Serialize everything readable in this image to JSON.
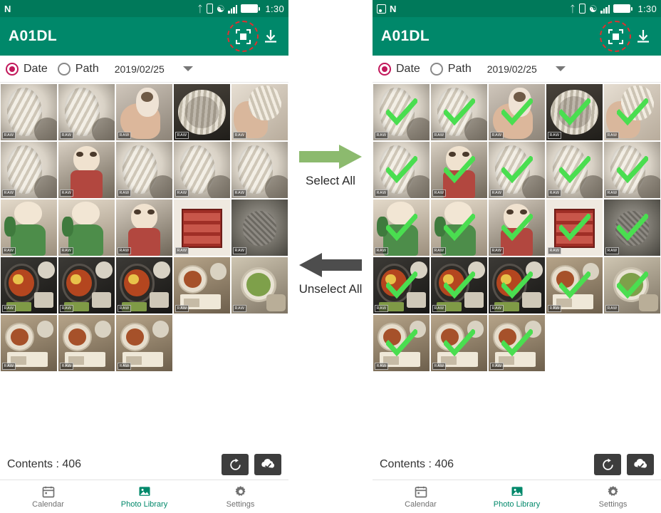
{
  "app": {
    "title": "A01DL",
    "brand_color": "#00886a",
    "status_bar_color": "#00795a",
    "accent_radio_color": "#c2185b",
    "check_color": "#4ade50"
  },
  "status_bar": {
    "clock": "1:30",
    "left_icons_left_phone": [
      "n-icon"
    ],
    "left_icons_right_phone": [
      "image-icon",
      "n-icon"
    ],
    "right_icons": [
      "bluetooth-icon",
      "vibrate-icon",
      "wifi-icon",
      "signal-bars-icon",
      "battery-icon"
    ]
  },
  "appbar": {
    "title": "A01DL",
    "select_all_icon": "select-all-icon",
    "download_icon": "download-icon",
    "highlight_color": "#e03030"
  },
  "filter": {
    "date_label": "Date",
    "path_label": "Path",
    "date_selected": true,
    "date_value": "2019/02/25",
    "dropdown_icon": "chevron-down-icon"
  },
  "footer": {
    "contents_label": "Contents : 406",
    "refresh_icon": "refresh-icon",
    "download_all_icon": "download-check-icon"
  },
  "navbar": {
    "items": [
      {
        "label": "Calendar",
        "icon": "calendar-icon",
        "active": false
      },
      {
        "label": "Photo Library",
        "icon": "photo-library-icon",
        "active": true
      },
      {
        "label": "Settings",
        "icon": "gear-icon",
        "active": false
      }
    ]
  },
  "center_annotations": [
    {
      "label": "Select All",
      "direction": "right",
      "color": "#8cba6e"
    },
    {
      "label": "Unselect All",
      "direction": "left",
      "color": "#4d4d4d"
    }
  ],
  "gallery": {
    "raw_badge": "RAW",
    "total_thumbnails": 23,
    "selected_in_right_phone": true,
    "thumbnails": [
      {
        "id": 1,
        "kind": "noodles-closeup",
        "raw": true
      },
      {
        "id": 2,
        "kind": "noodles-closeup",
        "raw": true
      },
      {
        "id": 3,
        "kind": "figure-hand",
        "raw": true
      },
      {
        "id": 4,
        "kind": "noodles-bowl-dark",
        "raw": true
      },
      {
        "id": 5,
        "kind": "noodles-hand",
        "raw": true
      },
      {
        "id": 6,
        "kind": "noodles-closeup",
        "raw": true
      },
      {
        "id": 7,
        "kind": "figure-doll",
        "raw": true
      },
      {
        "id": 8,
        "kind": "noodles-closeup",
        "raw": true
      },
      {
        "id": 9,
        "kind": "noodles-closeup",
        "raw": true
      },
      {
        "id": 10,
        "kind": "noodles-closeup",
        "raw": true
      },
      {
        "id": 11,
        "kind": "figure-green",
        "raw": true
      },
      {
        "id": 12,
        "kind": "figure-green",
        "raw": true
      },
      {
        "id": 13,
        "kind": "figure-doll",
        "raw": true
      },
      {
        "id": 14,
        "kind": "shelf-red",
        "raw": true
      },
      {
        "id": 15,
        "kind": "cat-gray",
        "raw": true
      },
      {
        "id": 16,
        "kind": "food-tray",
        "raw": true
      },
      {
        "id": 17,
        "kind": "food-tray",
        "raw": true
      },
      {
        "id": 18,
        "kind": "food-tray",
        "raw": true
      },
      {
        "id": 19,
        "kind": "food-table",
        "raw": true
      },
      {
        "id": 20,
        "kind": "matcha-cup",
        "raw": true
      },
      {
        "id": 21,
        "kind": "food-table",
        "raw": true
      },
      {
        "id": 22,
        "kind": "food-table",
        "raw": true
      },
      {
        "id": 23,
        "kind": "food-table",
        "raw": true
      }
    ]
  }
}
